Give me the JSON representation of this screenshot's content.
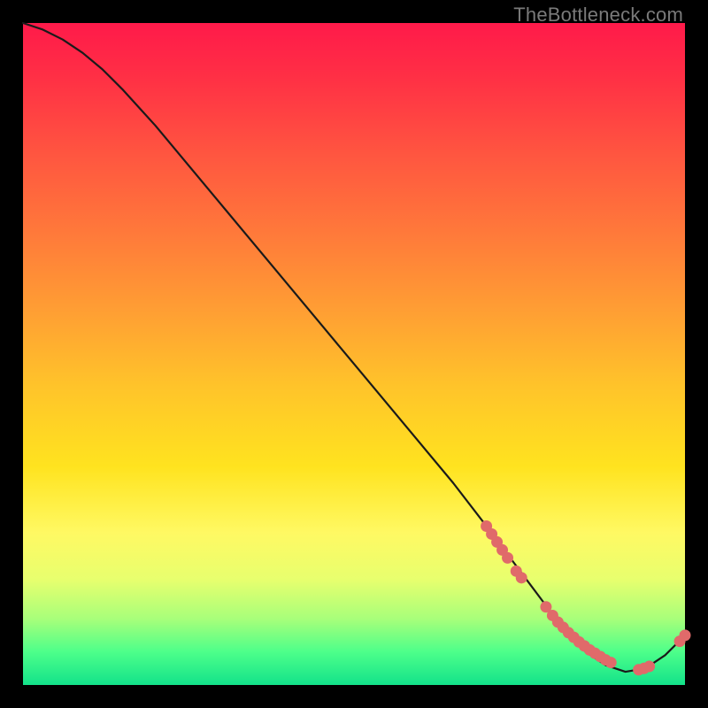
{
  "watermark": "TheBottleneck.com",
  "colors": {
    "background": "#000000",
    "curve_stroke": "#1a1a1a",
    "marker_fill": "#e06a6a",
    "marker_stroke": "#e06a6a",
    "watermark": "#7a7a7a"
  },
  "chart_data": {
    "type": "line",
    "title": "",
    "xlabel": "",
    "ylabel": "",
    "xlim": [
      0,
      100
    ],
    "ylim": [
      0,
      100
    ],
    "grid": false,
    "legend": false,
    "curve": {
      "x": [
        0,
        3,
        6,
        9,
        12,
        15,
        20,
        25,
        30,
        35,
        40,
        45,
        50,
        55,
        60,
        65,
        70,
        73,
        76,
        79,
        82,
        85,
        88,
        91,
        94,
        97,
        100
      ],
      "y": [
        100,
        99,
        97.5,
        95.5,
        93,
        90,
        84.5,
        78.5,
        72.5,
        66.5,
        60.5,
        54.5,
        48.5,
        42.5,
        36.5,
        30.5,
        24,
        20,
        16,
        12,
        8,
        5,
        3,
        2,
        2.5,
        4.5,
        7.5
      ]
    },
    "markers": {
      "x": [
        70,
        70.8,
        71.6,
        72.4,
        73.2,
        74.5,
        75.3,
        79,
        80,
        80.8,
        81.6,
        82.4,
        83.2,
        84,
        84.8,
        85.6,
        86.4,
        87.2,
        88,
        88.8,
        93,
        93.8,
        94.6,
        99.2,
        100
      ],
      "y": [
        24,
        22.8,
        21.6,
        20.4,
        19.2,
        17.2,
        16.2,
        11.8,
        10.5,
        9.5,
        8.7,
        7.9,
        7.2,
        6.5,
        5.9,
        5.3,
        4.8,
        4.3,
        3.8,
        3.4,
        2.3,
        2.5,
        2.8,
        6.6,
        7.5
      ]
    }
  }
}
